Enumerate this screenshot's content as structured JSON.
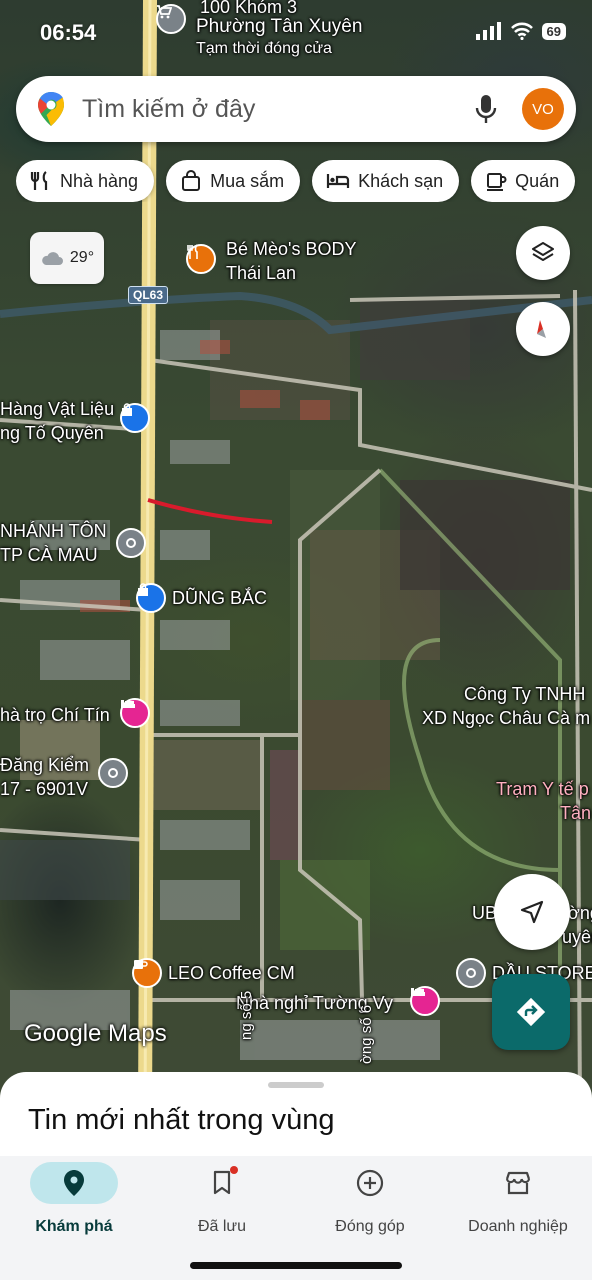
{
  "status_bar": {
    "time": "06:54",
    "battery": "69"
  },
  "search": {
    "placeholder": "Tìm kiếm ở đây",
    "avatar_initials": "VO"
  },
  "chips": [
    {
      "label": "Nhà hàng",
      "icon": "fork-knife-icon"
    },
    {
      "label": "Mua sắm",
      "icon": "shopping-bag-icon"
    },
    {
      "label": "Khách sạn",
      "icon": "bed-icon"
    },
    {
      "label": "Quán",
      "icon": "cup-icon"
    }
  ],
  "weather": {
    "temperature": "29°",
    "icon": "cloud-icon"
  },
  "map": {
    "road_shield": "QL63",
    "watermark": "Google Maps",
    "labels": {
      "top_1": "100 Khóm 3",
      "top_2": "Phường Tân Xuyên",
      "top_3": "Tạm thời đóng cửa",
      "be_meo_1": "Bé Mèo's BODY",
      "be_meo_2": "Thái Lan",
      "hang_vat_lieu_1": "Hàng Vật Liệu",
      "hang_vat_lieu_2": "ng Tố Quyên",
      "chi_nhanh_1": "NHÁNH TÔN",
      "chi_nhanh_2": "TP CÀ MAU",
      "dung_bac": "DŨNG BẮC",
      "cong_ty_1": "Công Ty TNHH",
      "cong_ty_2": "XD Ngọc Châu Cà m",
      "nha_tro": "hà trọ Chí Tín",
      "dang_kiem_1": "Đăng Kiểm",
      "dang_kiem_2": "17 - 6901V",
      "tram_y_te_1": "Trạm Y tế p",
      "tram_y_te_2": "Tân",
      "ub_1": "UB",
      "ub_2": "ường",
      "ub_3": "uyên",
      "leo_coffee": "LEO Coffee CM",
      "dau_store": "DẦU STORE",
      "nha_nghi": "Nhà nghỉ Tường Vy",
      "street_a": "ng số 5",
      "street_b": "ờng số 6"
    }
  },
  "sheet": {
    "title": "Tin mới nhất trong vùng"
  },
  "bottom_nav": [
    {
      "label": "Khám phá",
      "icon": "location-pin-icon",
      "active": true
    },
    {
      "label": "Đã lưu",
      "icon": "bookmark-icon",
      "active": false
    },
    {
      "label": "Đóng góp",
      "icon": "add-circle-icon",
      "active": false
    },
    {
      "label": "Doanh nghiệp",
      "icon": "storefront-icon",
      "active": false
    }
  ],
  "colors": {
    "accent_teal": "#0b6a6a",
    "active_nav_bg": "#bfe6ec",
    "avatar": "#e8710a",
    "poi_orange": "#e8710a",
    "poi_blue": "#1a73e8",
    "poi_pink": "#e52592",
    "poi_gray": "#7a8288"
  }
}
